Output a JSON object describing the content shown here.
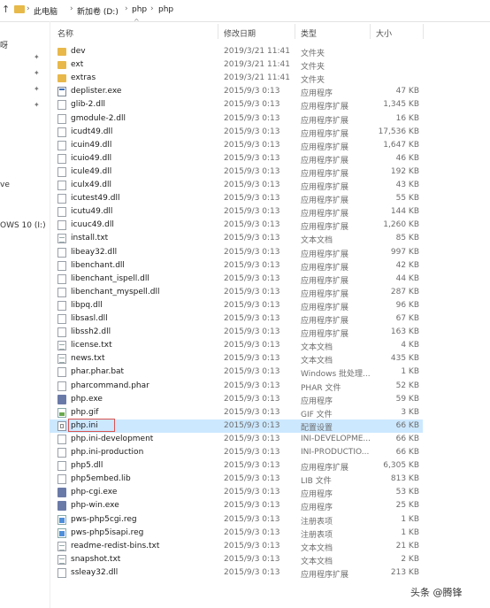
{
  "address_bar": {
    "up_arrow": "↑",
    "crumbs": [
      "此电脑",
      "新加卷 (D:)",
      "php",
      "php"
    ],
    "separator": "›"
  },
  "nav_fragments": [
    "呀",
    "ve",
    "OWS 10 (I:)"
  ],
  "columns": {
    "name": "名称",
    "date": "修改日期",
    "type": "类型",
    "size": "大小"
  },
  "files": [
    {
      "icon": "folder-icon",
      "name": "dev",
      "date": "2019/3/21 11:41",
      "type": "文件夹",
      "size": ""
    },
    {
      "icon": "folder-icon",
      "name": "ext",
      "date": "2019/3/21 11:41",
      "type": "文件夹",
      "size": ""
    },
    {
      "icon": "folder-icon",
      "name": "extras",
      "date": "2019/3/21 11:41",
      "type": "文件夹",
      "size": ""
    },
    {
      "icon": "exe-icon",
      "name": "deplister.exe",
      "date": "2015/9/3 0:13",
      "type": "应用程序",
      "size": "47 KB"
    },
    {
      "icon": "dll-icon",
      "name": "glib-2.dll",
      "date": "2015/9/3 0:13",
      "type": "应用程序扩展",
      "size": "1,345 KB"
    },
    {
      "icon": "dll-icon",
      "name": "gmodule-2.dll",
      "date": "2015/9/3 0:13",
      "type": "应用程序扩展",
      "size": "16 KB"
    },
    {
      "icon": "dll-icon",
      "name": "icudt49.dll",
      "date": "2015/9/3 0:13",
      "type": "应用程序扩展",
      "size": "17,536 KB"
    },
    {
      "icon": "dll-icon",
      "name": "icuin49.dll",
      "date": "2015/9/3 0:13",
      "type": "应用程序扩展",
      "size": "1,647 KB"
    },
    {
      "icon": "dll-icon",
      "name": "icuio49.dll",
      "date": "2015/9/3 0:13",
      "type": "应用程序扩展",
      "size": "46 KB"
    },
    {
      "icon": "dll-icon",
      "name": "icule49.dll",
      "date": "2015/9/3 0:13",
      "type": "应用程序扩展",
      "size": "192 KB"
    },
    {
      "icon": "dll-icon",
      "name": "iculx49.dll",
      "date": "2015/9/3 0:13",
      "type": "应用程序扩展",
      "size": "43 KB"
    },
    {
      "icon": "dll-icon",
      "name": "icutest49.dll",
      "date": "2015/9/3 0:13",
      "type": "应用程序扩展",
      "size": "55 KB"
    },
    {
      "icon": "dll-icon",
      "name": "icutu49.dll",
      "date": "2015/9/3 0:13",
      "type": "应用程序扩展",
      "size": "144 KB"
    },
    {
      "icon": "dll-icon",
      "name": "icuuc49.dll",
      "date": "2015/9/3 0:13",
      "type": "应用程序扩展",
      "size": "1,260 KB"
    },
    {
      "icon": "txt-icon",
      "name": "install.txt",
      "date": "2015/9/3 0:13",
      "type": "文本文档",
      "size": "85 KB"
    },
    {
      "icon": "dll-icon",
      "name": "libeay32.dll",
      "date": "2015/9/3 0:13",
      "type": "应用程序扩展",
      "size": "997 KB"
    },
    {
      "icon": "dll-icon",
      "name": "libenchant.dll",
      "date": "2015/9/3 0:13",
      "type": "应用程序扩展",
      "size": "42 KB"
    },
    {
      "icon": "dll-icon",
      "name": "libenchant_ispell.dll",
      "date": "2015/9/3 0:13",
      "type": "应用程序扩展",
      "size": "44 KB"
    },
    {
      "icon": "dll-icon",
      "name": "libenchant_myspell.dll",
      "date": "2015/9/3 0:13",
      "type": "应用程序扩展",
      "size": "287 KB"
    },
    {
      "icon": "dll-icon",
      "name": "libpq.dll",
      "date": "2015/9/3 0:13",
      "type": "应用程序扩展",
      "size": "96 KB"
    },
    {
      "icon": "dll-icon",
      "name": "libsasl.dll",
      "date": "2015/9/3 0:13",
      "type": "应用程序扩展",
      "size": "67 KB"
    },
    {
      "icon": "dll-icon",
      "name": "libssh2.dll",
      "date": "2015/9/3 0:13",
      "type": "应用程序扩展",
      "size": "163 KB"
    },
    {
      "icon": "txt-icon",
      "name": "license.txt",
      "date": "2015/9/3 0:13",
      "type": "文本文档",
      "size": "4 KB"
    },
    {
      "icon": "txt-icon",
      "name": "news.txt",
      "date": "2015/9/3 0:13",
      "type": "文本文档",
      "size": "435 KB"
    },
    {
      "icon": "file-icon",
      "name": "phar.phar.bat",
      "date": "2015/9/3 0:13",
      "type": "Windows 批处理...",
      "size": "1 KB"
    },
    {
      "icon": "file-icon",
      "name": "pharcommand.phar",
      "date": "2015/9/3 0:13",
      "type": "PHAR 文件",
      "size": "52 KB"
    },
    {
      "icon": "php-icon",
      "name": "php.exe",
      "date": "2015/9/3 0:13",
      "type": "应用程序",
      "size": "59 KB"
    },
    {
      "icon": "gif-icon",
      "name": "php.gif",
      "date": "2015/9/3 0:13",
      "type": "GIF 文件",
      "size": "3 KB"
    },
    {
      "icon": "ini-icon",
      "name": "php.ini",
      "date": "2015/9/3 0:13",
      "type": "配置设置",
      "size": "66 KB",
      "selected": true
    },
    {
      "icon": "file-icon",
      "name": "php.ini-development",
      "date": "2015/9/3 0:13",
      "type": "INI-DEVELOPME...",
      "size": "66 KB"
    },
    {
      "icon": "file-icon",
      "name": "php.ini-production",
      "date": "2015/9/3 0:13",
      "type": "INI-PRODUCTIO...",
      "size": "66 KB"
    },
    {
      "icon": "dll-icon",
      "name": "php5.dll",
      "date": "2015/9/3 0:13",
      "type": "应用程序扩展",
      "size": "6,305 KB"
    },
    {
      "icon": "file-icon",
      "name": "php5embed.lib",
      "date": "2015/9/3 0:13",
      "type": "LIB 文件",
      "size": "813 KB"
    },
    {
      "icon": "php-icon",
      "name": "php-cgi.exe",
      "date": "2015/9/3 0:13",
      "type": "应用程序",
      "size": "53 KB"
    },
    {
      "icon": "php-icon",
      "name": "php-win.exe",
      "date": "2015/9/3 0:13",
      "type": "应用程序",
      "size": "25 KB"
    },
    {
      "icon": "reg-icon",
      "name": "pws-php5cgi.reg",
      "date": "2015/9/3 0:13",
      "type": "注册表项",
      "size": "1 KB"
    },
    {
      "icon": "reg-icon",
      "name": "pws-php5isapi.reg",
      "date": "2015/9/3 0:13",
      "type": "注册表项",
      "size": "1 KB"
    },
    {
      "icon": "txt-icon",
      "name": "readme-redist-bins.txt",
      "date": "2015/9/3 0:13",
      "type": "文本文档",
      "size": "21 KB"
    },
    {
      "icon": "txt-icon",
      "name": "snapshot.txt",
      "date": "2015/9/3 0:13",
      "type": "文本文档",
      "size": "2 KB"
    },
    {
      "icon": "dll-icon",
      "name": "ssleay32.dll",
      "date": "2015/9/3 0:13",
      "type": "应用程序扩展",
      "size": "213 KB"
    }
  ],
  "watermark": "头条 @腾锋",
  "colors": {
    "selection": "#cce8ff",
    "highlight_border": "#d9534f",
    "folder": "#e8b84a"
  }
}
